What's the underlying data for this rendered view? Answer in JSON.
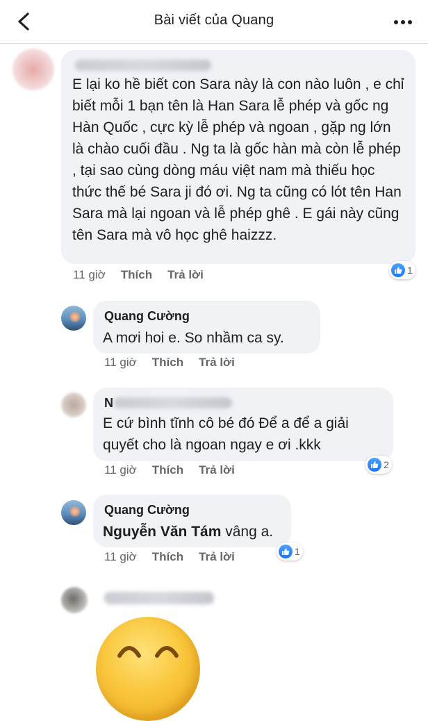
{
  "header": {
    "title": "Bài viết của Quang",
    "back_icon": "chevron-left-icon",
    "more_icon": "more-horizontal-icon"
  },
  "colors": {
    "bubble": "#f0f2f5",
    "meta_text": "#65676b",
    "like_blue": "#1877f2"
  },
  "comments": [
    {
      "author": "",
      "author_blurred": true,
      "text": "E lại ko hề biết con Sara này là con nào luôn , e chỉ biết mỗi 1 bạn tên là Han Sara lễ phép và gốc ng Hàn Quốc , cực kỳ lễ phép và ngoan , gặp ng lớn là chào cuối đầu . Ng ta là gốc hàn mà còn lễ phép , tại sao cùng dòng máu việt nam mà thiếu học thức thế bé Sara ji đó ơi. Ng ta cũng có lót tên Han Sara mà lại ngoan và lễ phép ghê . E gái này cũng tên Sara mà vô học ghê haizzz.",
      "time": "11 giờ",
      "like_label": "Thích",
      "reply_label": "Trả lời",
      "reactions": "1"
    },
    {
      "author": "Quang Cường",
      "text": "A mơi hoi e. So nhầm ca sy.",
      "time": "11 giờ",
      "like_label": "Thích",
      "reply_label": "Trả lời"
    },
    {
      "author": "N",
      "author_blurred": true,
      "text": "E cứ bình tĩnh cô bé đó Để a để a giải quyết cho là ngoan ngay e ơi .kkk",
      "time": "11 giờ",
      "like_label": "Thích",
      "reply_label": "Trả lời",
      "reactions": "2"
    },
    {
      "author": "Quang Cường",
      "mention": "Nguyễn Văn Tám",
      "text": " vâng a.",
      "time": "11 giờ",
      "like_label": "Thích",
      "reply_label": "Trả lời",
      "reactions": "1"
    },
    {
      "author": "",
      "author_blurred": true,
      "sticker": "laughing-face-sticker"
    }
  ]
}
